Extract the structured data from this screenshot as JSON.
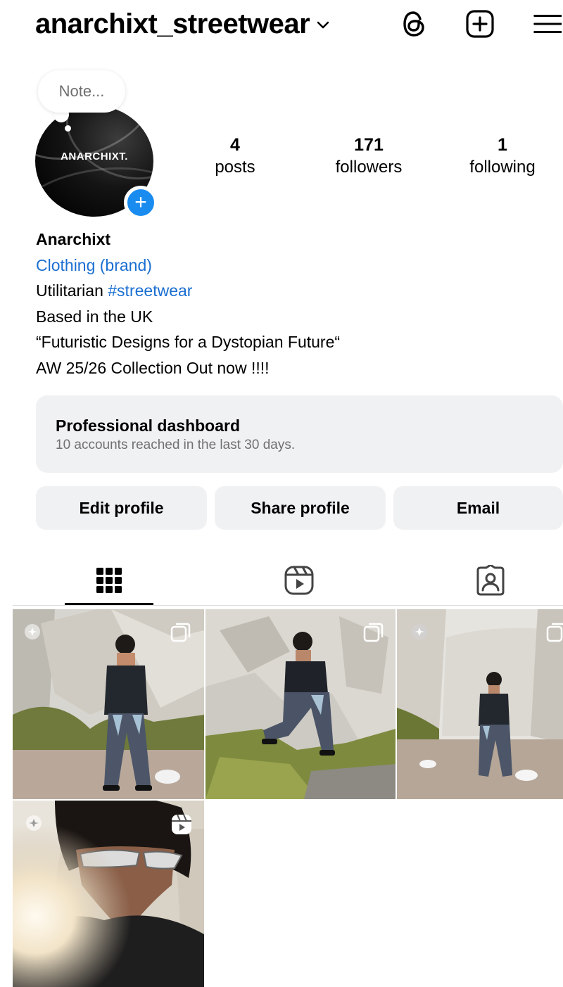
{
  "header": {
    "username": "anarchixt_streetwear"
  },
  "note": {
    "placeholder": "Note..."
  },
  "avatar": {
    "brand_text": "ANARCHIXT.",
    "add_symbol": "+"
  },
  "stats": [
    {
      "value": "4",
      "label": "posts"
    },
    {
      "value": "171",
      "label": "followers"
    },
    {
      "value": "1",
      "label": "following"
    }
  ],
  "bio": {
    "name": "Anarchixt",
    "category": "Clothing (brand)",
    "line1_text": "Utilitarian ",
    "line1_hashtag": "#streetwear",
    "line2": "Based in the UK",
    "line3": "“Futuristic Designs for a Dystopian Future“",
    "line4": "AW 25/26 Collection Out now !!!!"
  },
  "dashboard": {
    "title": "Professional dashboard",
    "subtitle": "10 accounts reached in the last 30 days."
  },
  "buttons": {
    "edit": "Edit profile",
    "share": "Share profile",
    "email": "Email"
  },
  "tabs": [
    {
      "name": "posts-grid",
      "icon": "grid-icon",
      "active": true
    },
    {
      "name": "reels",
      "icon": "reels-icon",
      "active": false
    },
    {
      "name": "tagged",
      "icon": "tagged-person-icon",
      "active": false
    }
  ],
  "posts": [
    {
      "overlay_icon": "carousel-icon",
      "pinned": true
    },
    {
      "overlay_icon": "carousel-icon",
      "pinned": false
    },
    {
      "overlay_icon": "carousel-icon",
      "pinned": true
    },
    {
      "overlay_icon": "reels-icon",
      "pinned": true
    }
  ],
  "colors": {
    "link": "#1b6fd1",
    "add_story": "#1a8cf0",
    "card_bg": "#f0f1f3"
  }
}
